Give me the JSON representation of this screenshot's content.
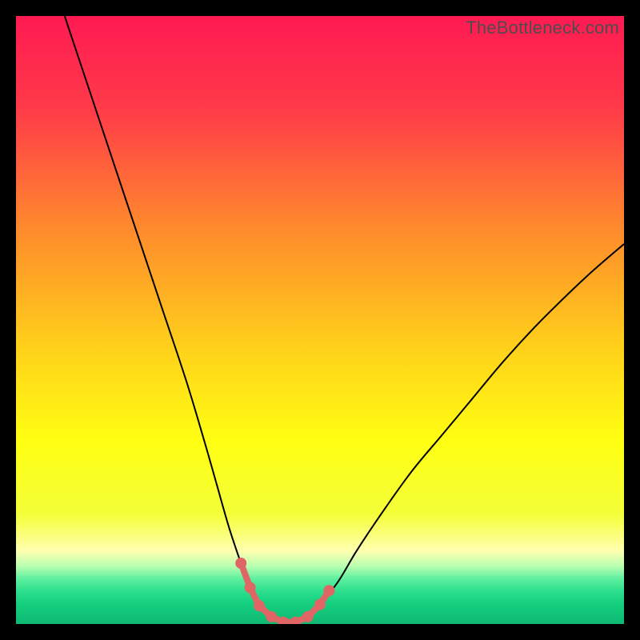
{
  "watermark": "TheBottleneck.com",
  "chart_data": {
    "type": "line",
    "title": "",
    "xlabel": "",
    "ylabel": "",
    "xlim": [
      0,
      100
    ],
    "ylim": [
      0,
      100
    ],
    "grid": false,
    "legend": false,
    "background_gradient": {
      "stops": [
        {
          "pos": 0.0,
          "color": "#ff1a52"
        },
        {
          "pos": 0.15,
          "color": "#ff3a49"
        },
        {
          "pos": 0.35,
          "color": "#ff8a2c"
        },
        {
          "pos": 0.55,
          "color": "#ffd21a"
        },
        {
          "pos": 0.7,
          "color": "#ffff12"
        },
        {
          "pos": 0.82,
          "color": "#f4ff3a"
        },
        {
          "pos": 0.88,
          "color": "#ffffb0"
        },
        {
          "pos": 0.905,
          "color": "#b8ffb0"
        },
        {
          "pos": 0.925,
          "color": "#60f0a0"
        },
        {
          "pos": 0.945,
          "color": "#2fe08e"
        },
        {
          "pos": 0.965,
          "color": "#15d07f"
        },
        {
          "pos": 1.0,
          "color": "#0fb873"
        }
      ]
    },
    "series": [
      {
        "name": "bottleneck-curve",
        "color": "#000000",
        "width": 2,
        "x": [
          8,
          12,
          16,
          20,
          24,
          28,
          31,
          33,
          35,
          37,
          38.5,
          40,
          42,
          44,
          46,
          48,
          50,
          53,
          56,
          60,
          65,
          70,
          75,
          80,
          85,
          90,
          95,
          100
        ],
        "y": [
          100,
          88,
          76,
          64,
          52,
          40,
          30,
          23,
          16,
          10,
          6,
          3,
          1.2,
          0.3,
          0.3,
          1.2,
          3.2,
          7,
          12,
          18,
          25,
          31,
          37,
          43,
          48.5,
          53.5,
          58.2,
          62.5
        ]
      }
    ],
    "markers": {
      "name": "valley-markers",
      "color": "#e06666",
      "stroke_width": 8,
      "radius": 7,
      "points_x": [
        37,
        38.5,
        40,
        42,
        44,
        46,
        48,
        50,
        51.5
      ],
      "points_y": [
        10,
        6,
        3,
        1.2,
        0.3,
        0.3,
        1.2,
        3.2,
        5.5
      ]
    }
  }
}
